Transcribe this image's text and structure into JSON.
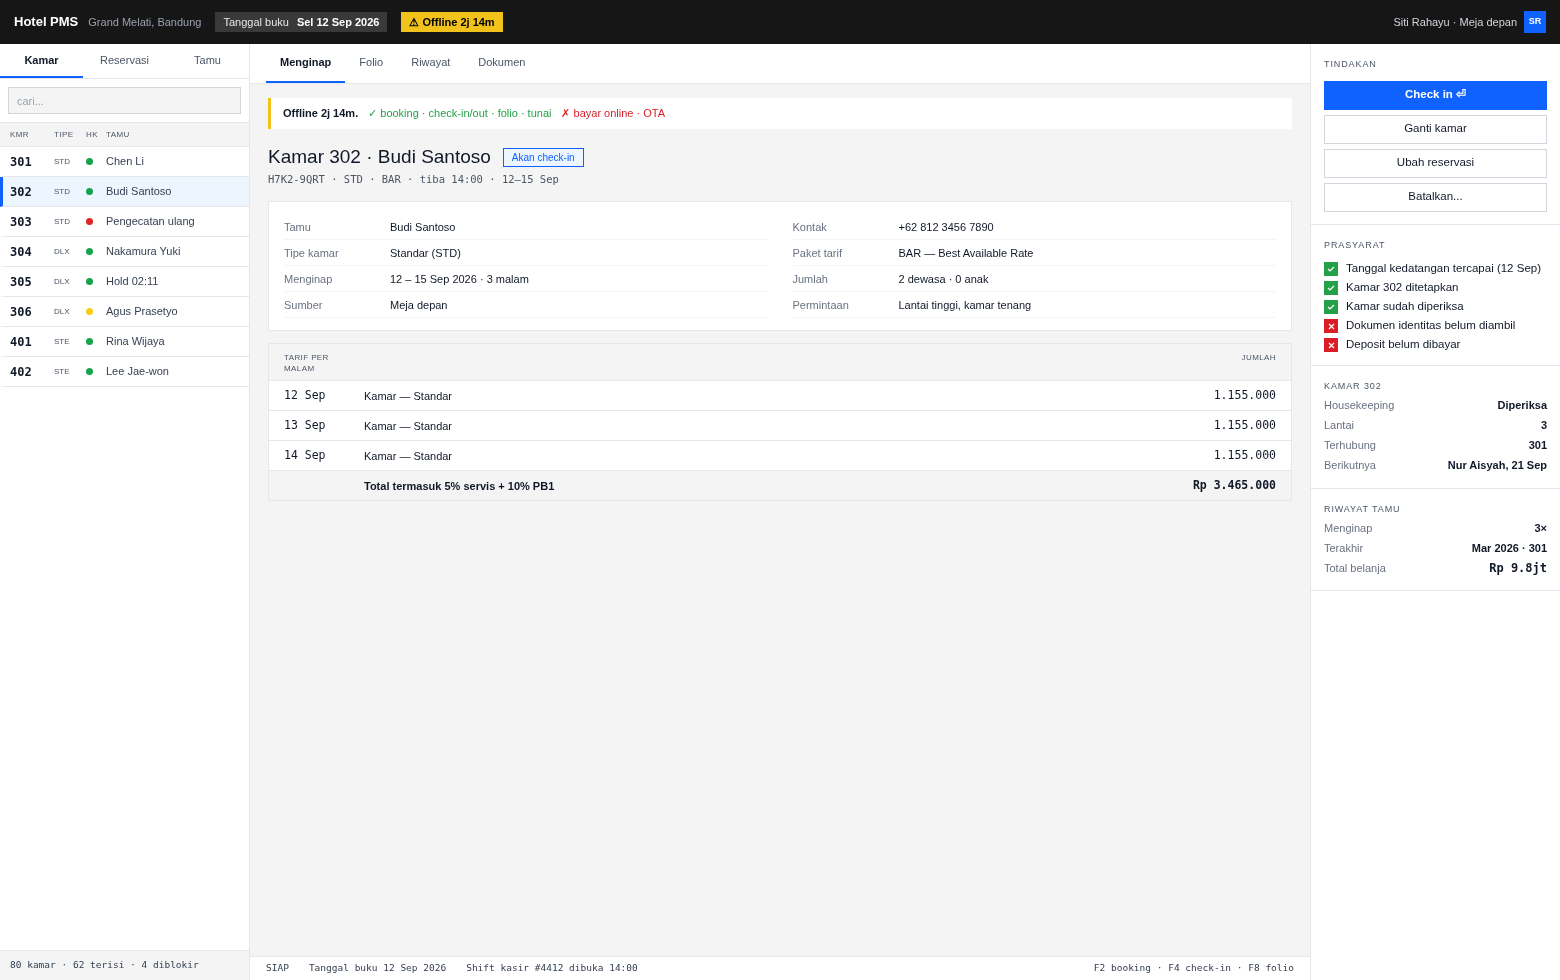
{
  "header": {
    "app": "Hotel PMS",
    "property": "Grand Melati, Bandung",
    "book_date_label": "Tanggal buku",
    "book_date": "Sel 12 Sep 2026",
    "offline_badge": "⚠ Offline 2j 14m",
    "user": "Siti Rahayu · Meja depan",
    "avatar": "SR"
  },
  "sidebar": {
    "tabs": [
      {
        "label": "Kamar",
        "selected": true
      },
      {
        "label": "Reservasi",
        "selected": false
      },
      {
        "label": "Tamu",
        "selected": false
      }
    ],
    "search": {
      "placeholder": "cari..."
    },
    "columns": [
      "KMR",
      "TIPE",
      "HK",
      "TAMU"
    ],
    "rooms": [
      {
        "number": "301",
        "type": "STD",
        "color": "#16a34a",
        "guest": "Chen Li",
        "selected": false
      },
      {
        "number": "302",
        "type": "STD",
        "color": "#16a34a",
        "guest": "Budi Santoso",
        "selected": true
      },
      {
        "number": "303",
        "type": "STD",
        "color": "#dc2626",
        "guest": "Pengecatan ulang",
        "selected": false
      },
      {
        "number": "304",
        "type": "DLX",
        "color": "#16a34a",
        "guest": "Nakamura Yuki",
        "selected": false
      },
      {
        "number": "305",
        "type": "DLX",
        "color": "#16a34a",
        "guest": "Hold 02:11",
        "selected": false
      },
      {
        "number": "306",
        "type": "DLX",
        "color": "#facc15",
        "guest": "Agus Prasetyo",
        "selected": false
      },
      {
        "number": "401",
        "type": "STE",
        "color": "#16a34a",
        "guest": "Rina Wijaya",
        "selected": false
      },
      {
        "number": "402",
        "type": "STE",
        "color": "#16a34a",
        "guest": "Lee Jae-won",
        "selected": false
      }
    ],
    "footer": "80 kamar · 62 terisi · 4 diblokir"
  },
  "main": {
    "tabs": [
      {
        "label": "Menginap",
        "selected": true
      },
      {
        "label": "Folio",
        "selected": false
      },
      {
        "label": "Riwayat",
        "selected": false
      },
      {
        "label": "Dokumen",
        "selected": false
      }
    ],
    "banner": {
      "title": "Offline 2j 14m.",
      "available": "✓ booking · check-in/out · folio · tunai",
      "unavailable": "✗ bayar online · OTA"
    },
    "title": "Kamar 302 · Budi Santoso",
    "status_badge": "Akan check-in",
    "subtitle": "H7K2-9QRT · STD · BAR · tiba 14:00 · 12–15 Sep",
    "details_left": [
      {
        "label": "Tamu",
        "value": "Budi Santoso"
      },
      {
        "label": "Tipe kamar",
        "value": "Standar (STD)"
      },
      {
        "label": "Menginap",
        "value": "12 – 15 Sep 2026 · 3 malam"
      },
      {
        "label": "Sumber",
        "value": "Meja depan"
      }
    ],
    "details_right": [
      {
        "label": "Kontak",
        "value": "+62 812 3456 7890"
      },
      {
        "label": "Paket tarif",
        "value": "BAR — Best Available Rate"
      },
      {
        "label": "Jumlah",
        "value": "2 dewasa · 0 anak"
      },
      {
        "label": "Permintaan",
        "value": "Lantai tinggi, kamar tenang"
      }
    ],
    "rate_table": {
      "columns": [
        "TARIF PER MALAM",
        "JUMLAH"
      ],
      "rows": [
        {
          "date": "12 Sep",
          "item": "Kamar — Standar",
          "amount": "1.155.000"
        },
        {
          "date": "13 Sep",
          "item": "Kamar — Standar",
          "amount": "1.155.000"
        },
        {
          "date": "14 Sep",
          "item": "Kamar — Standar",
          "amount": "1.155.000"
        }
      ],
      "total_label": "Total termasuk 5% servis + 10% PB1",
      "total": "Rp 3.465.000"
    }
  },
  "status_bar": {
    "left": [
      "SIAP",
      "Tanggal buku 12 Sep 2026",
      "Shift kasir #4412 dibuka 14:00"
    ],
    "right": "F2 booking · F4 check-in · F8 folio"
  },
  "right_panel": {
    "actions_title": "TINDAKAN",
    "actions": [
      {
        "label": "Check in ⏎",
        "kind": "primary"
      },
      {
        "label": "Ganti kamar",
        "kind": "secondary"
      },
      {
        "label": "Ubah reservasi",
        "kind": "secondary"
      },
      {
        "label": "Batalkan...",
        "kind": "secondary"
      }
    ],
    "prereq_title": "PRASYARAT",
    "prerequisites": [
      {
        "label": "Tanggal kedatangan tercapai (12 Sep)",
        "kind": "met"
      },
      {
        "label": "Kamar 302 ditetapkan",
        "kind": "met"
      },
      {
        "label": "Kamar sudah diperiksa",
        "kind": "met"
      },
      {
        "label": "Dokumen identitas belum diambil",
        "kind": "unmet"
      },
      {
        "label": "Deposit belum dibayar",
        "kind": "unmet"
      }
    ],
    "room_title": "KAMAR 302",
    "room_info": [
      {
        "label": "Housekeeping",
        "value": "Diperiksa"
      },
      {
        "label": "Lantai",
        "value": "3"
      },
      {
        "label": "Terhubung",
        "value": "301"
      },
      {
        "label": "Berikutnya",
        "value": "Nur Aisyah, 21 Sep"
      }
    ],
    "history_title": "RIWAYAT TAMU",
    "history": [
      {
        "label": "Menginap",
        "value": "3×"
      },
      {
        "label": "Terakhir",
        "value": "Mar 2026 · 301"
      },
      {
        "label": "Total belanja",
        "value": "Rp 9.8jt",
        "kind": "mono"
      }
    ]
  }
}
